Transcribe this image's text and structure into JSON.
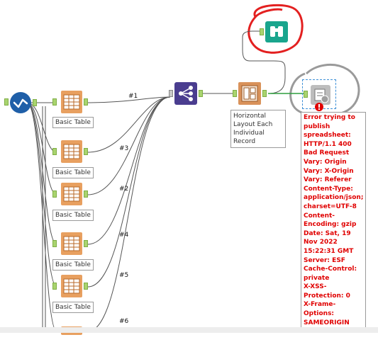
{
  "workflow": {
    "tools": {
      "basic_table_label": "Basic Table",
      "horizontal_layout_label": "Horizontal Layout Each Individual Record"
    },
    "connections": {
      "c1": "#1",
      "c2": "#2",
      "c3": "#3",
      "c4": "#4",
      "c5": "#5",
      "c6": "#6"
    },
    "error": {
      "text": "Error trying to publish spreadsheet: HTTP/1.1 400 Bad Request\nVary: Origin\nVary: X-Origin\nVary: Referer\nContent-Type: application/json; charset=UTF-8\nContent-Encoding: gzip\nDate: Sat, 19 Nov 2022 15:22:31 GMT\nServer: ESF\nCache-Control: private\nX-XSS-Protection: 0\nX-Frame-Options: SAMEORIGIN\nX-Content-Type-Options: nosniff"
    },
    "colors": {
      "anchor": "#a9d46f",
      "table_tool": "#e8a060",
      "layout_tool": "#d9925a",
      "browse_tool": "#19a58d",
      "union_tool": "#4a3d8f",
      "dynamic_input": "#1f5fa8",
      "error_red": "#e00000",
      "annotation_red": "#e32020",
      "annotation_gray": "#9a9a9a"
    },
    "icons": [
      "check-circle-icon",
      "table-icon",
      "union-icon",
      "layout-icon",
      "binoculars-icon",
      "output-icon",
      "error-icon"
    ]
  }
}
